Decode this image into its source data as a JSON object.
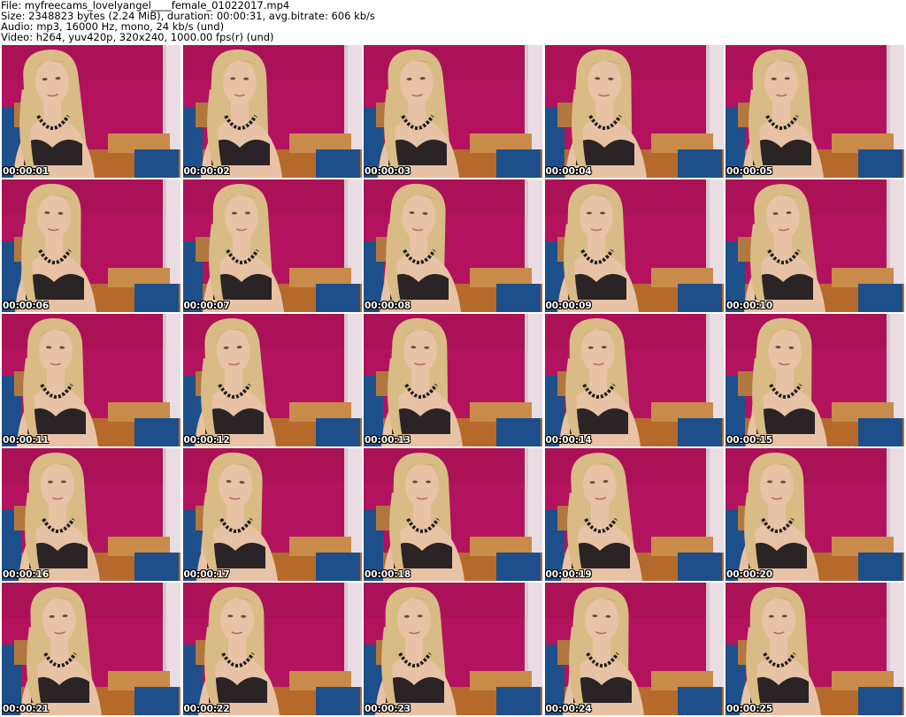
{
  "header": {
    "file_line": "File: myfreecams_lovelyangel____female_01022017.mp4",
    "size_line": "Size: 2348823 bytes (2.24 MiB), duration: 00:00:31, avg.bitrate: 606 kb/s",
    "audio_line": "Audio: mp3, 16000 Hz, mono, 24 kb/s (und)",
    "video_line": "Video: h264, yuv420p, 320x240, 1000.00 fps(r) (und)"
  },
  "colors": {
    "wall": "#b3135e",
    "floor": "#b56a2c",
    "chair": "#1d4f8a",
    "curtain": "#e9dde3",
    "hair": "#d9bb86",
    "skin": "#e8c2a4",
    "bra": "#2a2426"
  },
  "thumbnails": [
    {
      "timestamp": "00:00:01",
      "image": "video-frame"
    },
    {
      "timestamp": "00:00:02",
      "image": "video-frame"
    },
    {
      "timestamp": "00:00:03",
      "image": "video-frame"
    },
    {
      "timestamp": "00:00:04",
      "image": "video-frame"
    },
    {
      "timestamp": "00:00:05",
      "image": "video-frame"
    },
    {
      "timestamp": "00:00:06",
      "image": "video-frame"
    },
    {
      "timestamp": "00:00:07",
      "image": "video-frame"
    },
    {
      "timestamp": "00:00:08",
      "image": "video-frame"
    },
    {
      "timestamp": "00:00:09",
      "image": "video-frame"
    },
    {
      "timestamp": "00:00:10",
      "image": "video-frame"
    },
    {
      "timestamp": "00:00:11",
      "image": "video-frame"
    },
    {
      "timestamp": "00:00:12",
      "image": "video-frame"
    },
    {
      "timestamp": "00:00:13",
      "image": "video-frame"
    },
    {
      "timestamp": "00:00:14",
      "image": "video-frame"
    },
    {
      "timestamp": "00:00:15",
      "image": "video-frame"
    },
    {
      "timestamp": "00:00:16",
      "image": "video-frame"
    },
    {
      "timestamp": "00:00:17",
      "image": "video-frame"
    },
    {
      "timestamp": "00:00:18",
      "image": "video-frame"
    },
    {
      "timestamp": "00:00:19",
      "image": "video-frame"
    },
    {
      "timestamp": "00:00:20",
      "image": "video-frame"
    },
    {
      "timestamp": "00:00:21",
      "image": "video-frame"
    },
    {
      "timestamp": "00:00:22",
      "image": "video-frame"
    },
    {
      "timestamp": "00:00:23",
      "image": "video-frame"
    },
    {
      "timestamp": "00:00:24",
      "image": "video-frame"
    },
    {
      "timestamp": "00:00:25",
      "image": "video-frame"
    }
  ]
}
